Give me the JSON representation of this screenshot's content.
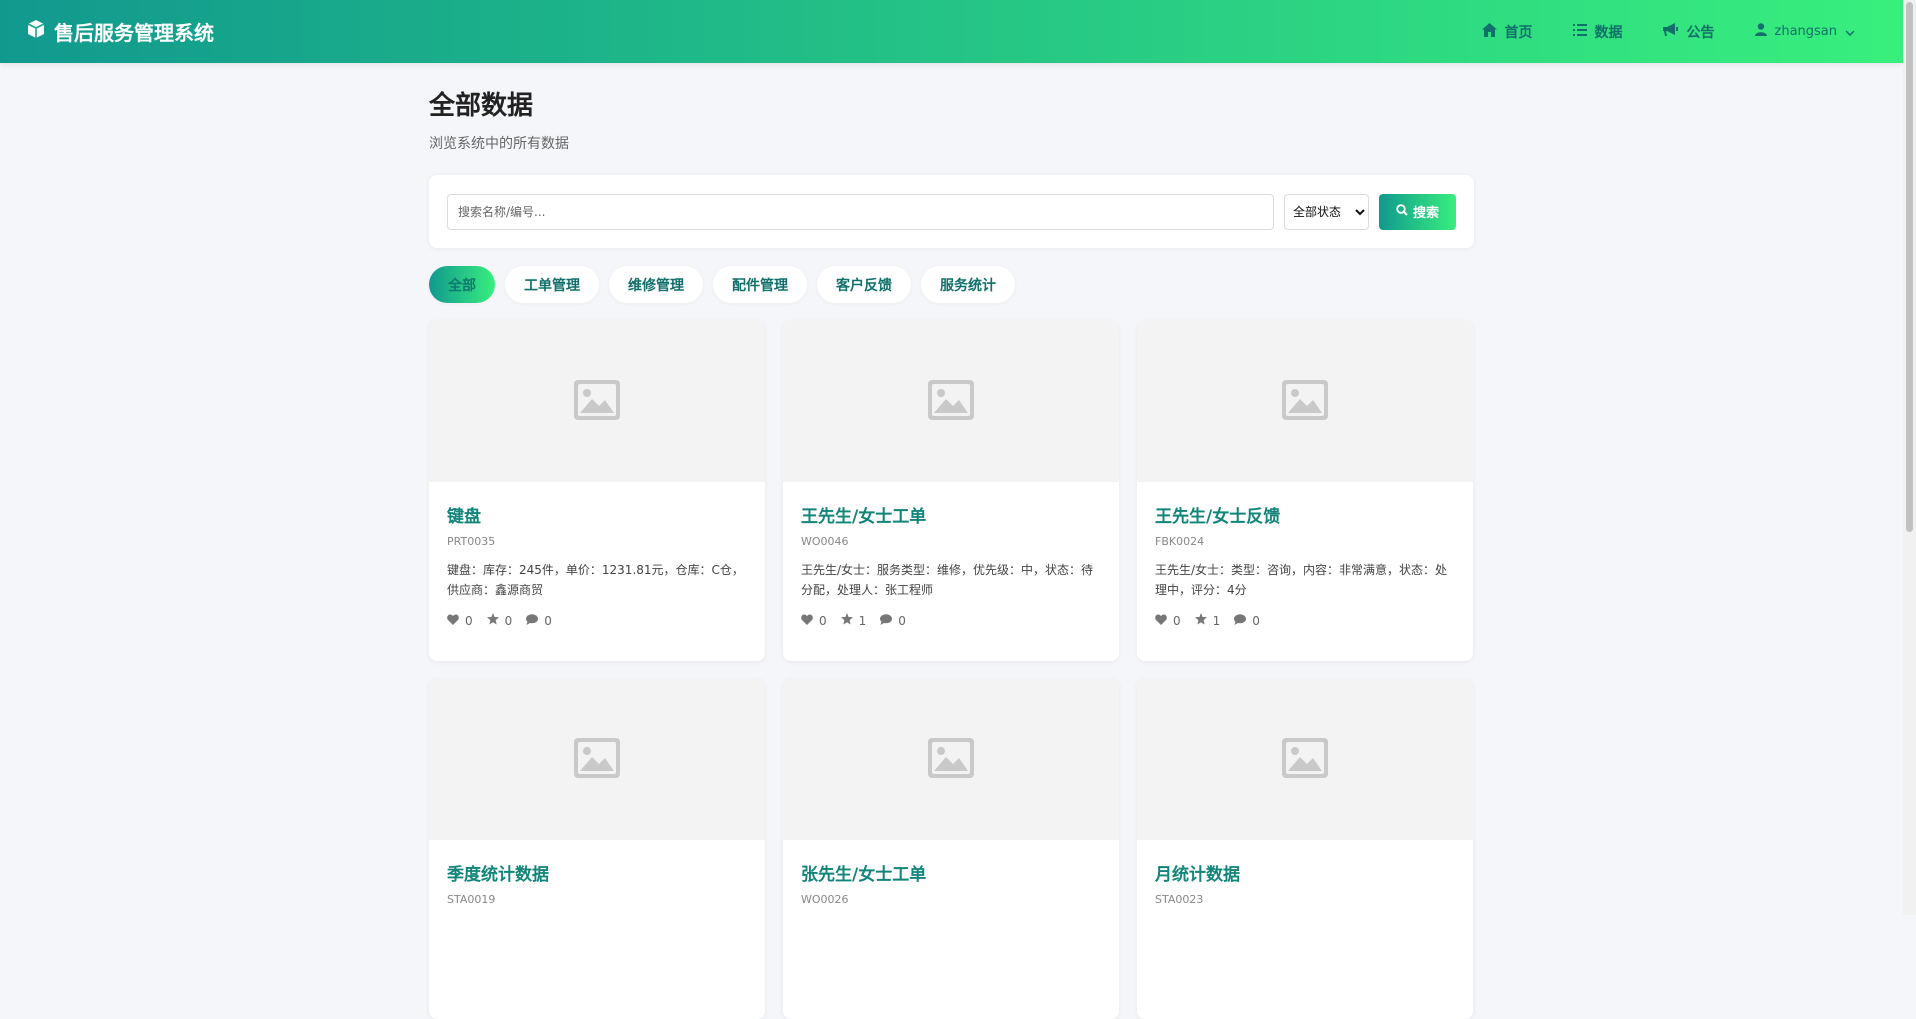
{
  "app": {
    "title": "售后服务管理系统"
  },
  "nav": {
    "home": "首页",
    "data": "数据",
    "notice": "公告",
    "user": "zhangsan"
  },
  "page": {
    "title": "全部数据",
    "subtitle": "浏览系统中的所有数据"
  },
  "search": {
    "placeholder": "搜索名称/编号...",
    "status_selected": "全部状态",
    "button": "搜索"
  },
  "tabs": [
    "全部",
    "工单管理",
    "维修管理",
    "配件管理",
    "客户反馈",
    "服务统计"
  ],
  "cards": [
    {
      "title": "键盘",
      "code": "PRT0035",
      "desc": "键盘：库存：245件，单价：1231.81元，仓库：C仓，供应商：鑫源商贸",
      "likes": "0",
      "stars": "0",
      "comments": "0"
    },
    {
      "title": "王先生/女士工单",
      "code": "WO0046",
      "desc": "王先生/女士：服务类型：维修，优先级：中，状态：待分配，处理人：张工程师",
      "likes": "0",
      "stars": "1",
      "comments": "0"
    },
    {
      "title": "王先生/女士反馈",
      "code": "FBK0024",
      "desc": "王先生/女士：类型：咨询，内容：非常满意，状态：处理中，评分：4分",
      "likes": "0",
      "stars": "1",
      "comments": "0"
    },
    {
      "title": "季度统计数据",
      "code": "STA0019",
      "desc": "",
      "likes": "",
      "stars": "",
      "comments": ""
    },
    {
      "title": "张先生/女士工单",
      "code": "WO0026",
      "desc": "",
      "likes": "",
      "stars": "",
      "comments": ""
    },
    {
      "title": "月统计数据",
      "code": "STA0023",
      "desc": "",
      "likes": "",
      "stars": "",
      "comments": ""
    }
  ],
  "colors": {
    "accent_start": "#11998e",
    "accent_end": "#38ef7d",
    "title_green": "#11857a"
  }
}
